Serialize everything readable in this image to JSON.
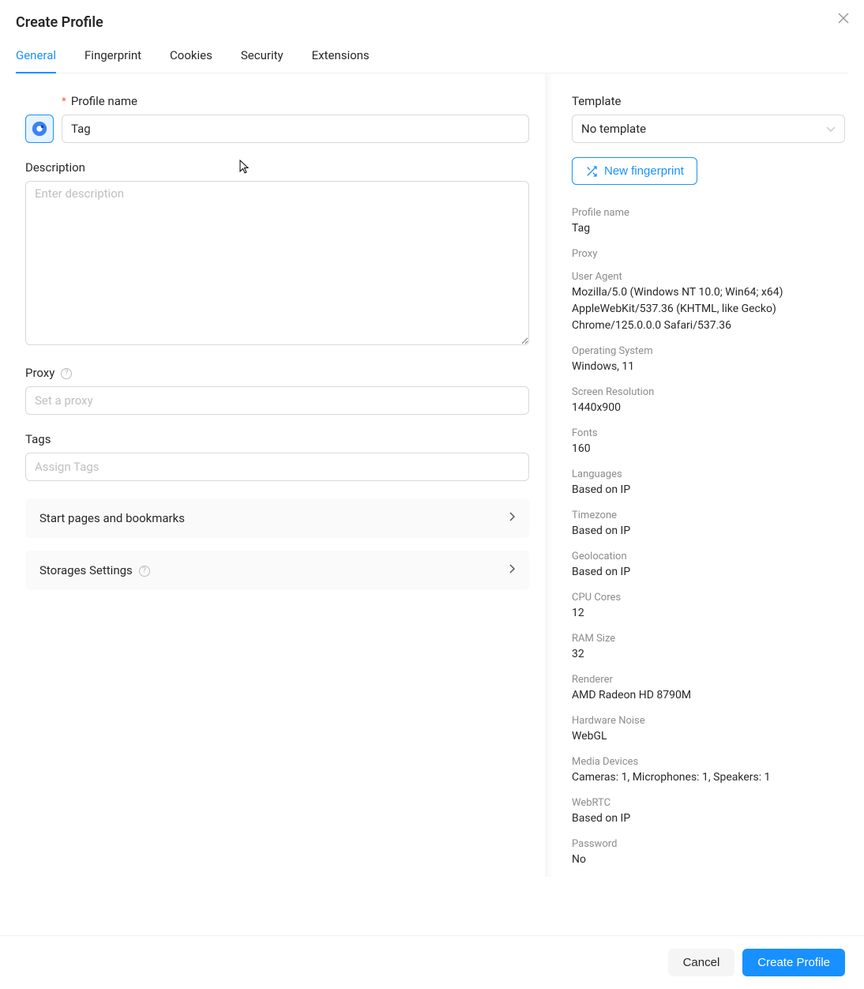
{
  "header": {
    "title": "Create Profile"
  },
  "tabs": [
    "General",
    "Fingerprint",
    "Cookies",
    "Security",
    "Extensions"
  ],
  "active_tab": 0,
  "form": {
    "profile_name_label": "Profile name",
    "profile_name_value": "Tag",
    "description_label": "Description",
    "description_placeholder": "Enter description",
    "proxy_label": "Proxy",
    "proxy_placeholder": "Set a proxy",
    "tags_label": "Tags",
    "tags_placeholder": "Assign Tags",
    "collapse_start_pages": "Start pages and bookmarks",
    "collapse_storages": "Storages Settings"
  },
  "sidebar": {
    "template_label": "Template",
    "template_value": "No template",
    "new_fingerprint_label": "New fingerprint",
    "details": [
      {
        "label": "Profile name",
        "value": "Tag"
      },
      {
        "label": "Proxy",
        "value": ""
      },
      {
        "label": "User Agent",
        "value": "Mozilla/5.0 (Windows NT 10.0; Win64; x64) AppleWebKit/537.36 (KHTML, like Gecko) Chrome/125.0.0.0 Safari/537.36"
      },
      {
        "label": "Operating System",
        "value": "Windows, 11"
      },
      {
        "label": "Screen Resolution",
        "value": "1440x900"
      },
      {
        "label": "Fonts",
        "value": "160"
      },
      {
        "label": "Languages",
        "value": "Based on IP"
      },
      {
        "label": "Timezone",
        "value": "Based on IP"
      },
      {
        "label": "Geolocation",
        "value": "Based on IP"
      },
      {
        "label": "CPU Cores",
        "value": "12"
      },
      {
        "label": "RAM Size",
        "value": "32"
      },
      {
        "label": "Renderer",
        "value": "AMD Radeon HD 8790M"
      },
      {
        "label": "Hardware Noise",
        "value": "WebGL"
      },
      {
        "label": "Media Devices",
        "value": "Cameras: 1, Microphones: 1, Speakers: 1"
      },
      {
        "label": "WebRTC",
        "value": "Based on IP"
      },
      {
        "label": "Password",
        "value": "No"
      }
    ]
  },
  "footer": {
    "cancel": "Cancel",
    "create": "Create Profile"
  }
}
